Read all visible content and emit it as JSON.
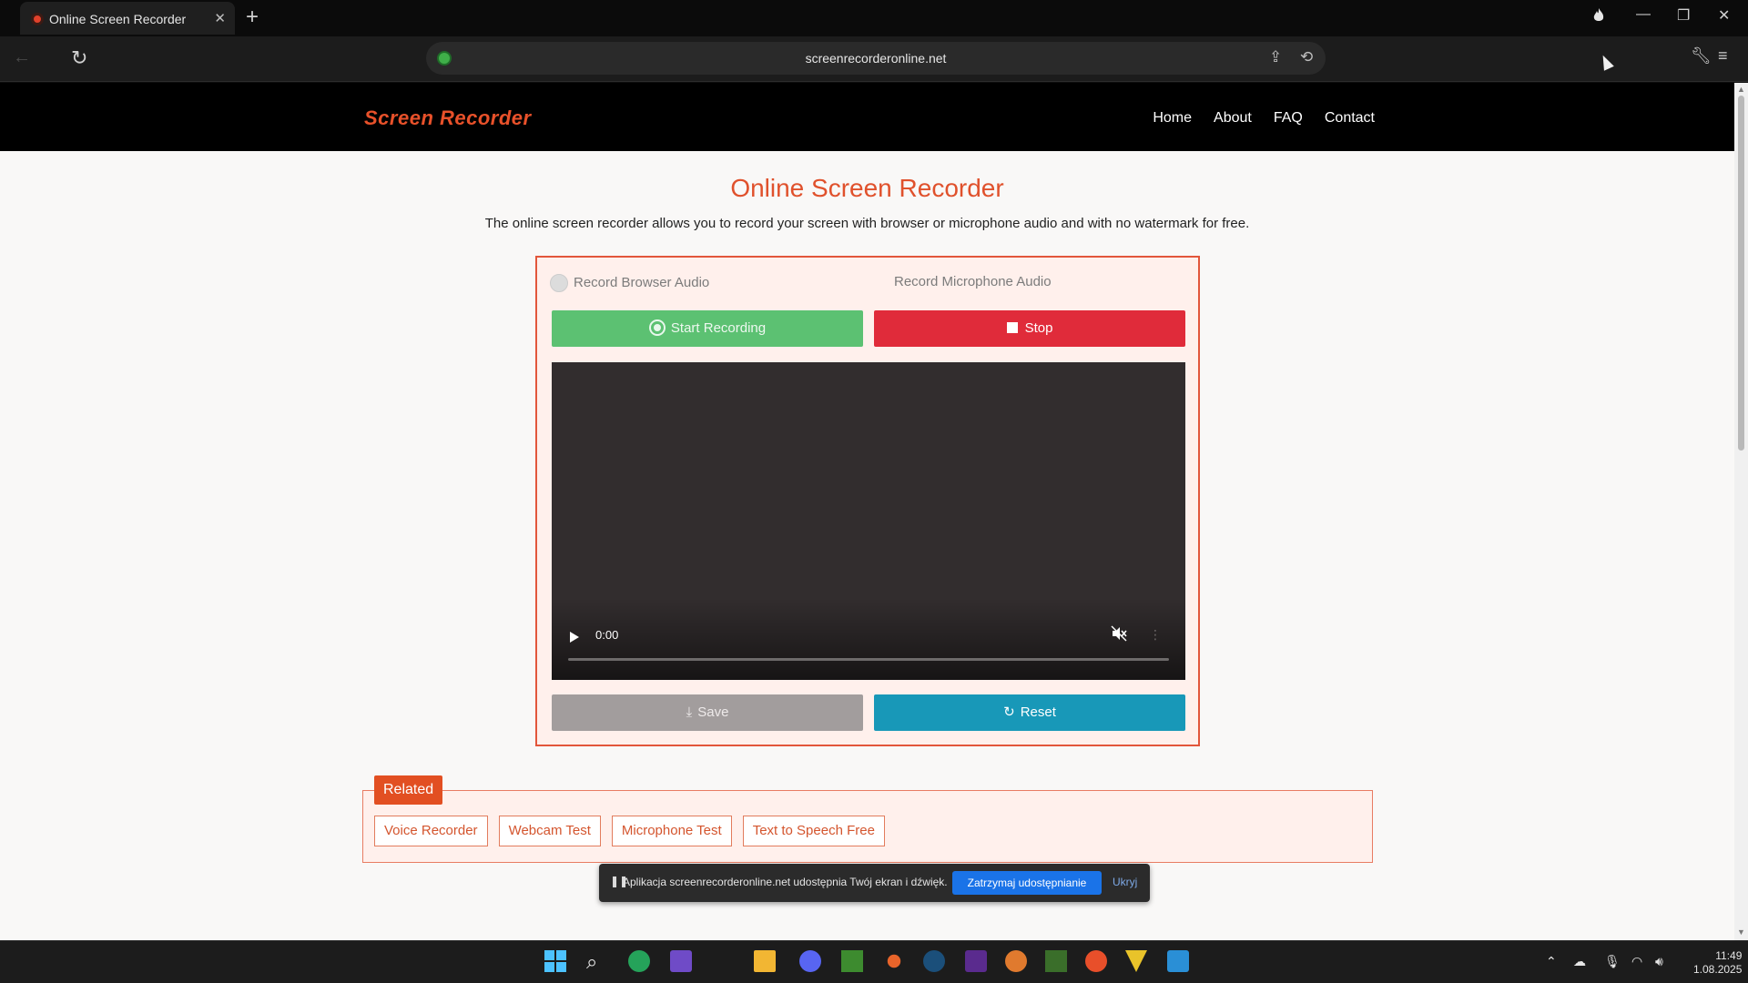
{
  "browser": {
    "tab_title": "Online Screen Recorder",
    "url": "screenrecorderonline.net"
  },
  "site": {
    "logo": "Screen Recorder",
    "nav": [
      "Home",
      "About",
      "FAQ",
      "Contact"
    ]
  },
  "main": {
    "title": "Online Screen Recorder",
    "description": "The online screen recorder allows you to record your screen with browser or microphone audio and with no watermark for free."
  },
  "recorder": {
    "option_browser_audio": "Record Browser Audio",
    "option_mic_audio": "Record Microphone Audio",
    "start_label": "Start Recording",
    "stop_label": "Stop",
    "video_time": "0:00",
    "save_label": "Save",
    "reset_label": "Reset"
  },
  "related": {
    "tag": "Related",
    "links": [
      "Voice Recorder",
      "Webcam Test",
      "Microphone Test",
      "Text to Speech Free"
    ]
  },
  "share_bar": {
    "message": "Aplikacja screenrecorderonline.net udostępnia Twój ekran i dźwięk.",
    "stop_label": "Zatrzymaj udostępnianie",
    "hide_label": "Ukryj"
  },
  "taskbar": {
    "time": "11:49",
    "date": "1.08.2025"
  },
  "colors": {
    "brand": "#e0512c",
    "start": "#5cc172",
    "stop": "#e02b3a",
    "reset": "#1898b8"
  }
}
